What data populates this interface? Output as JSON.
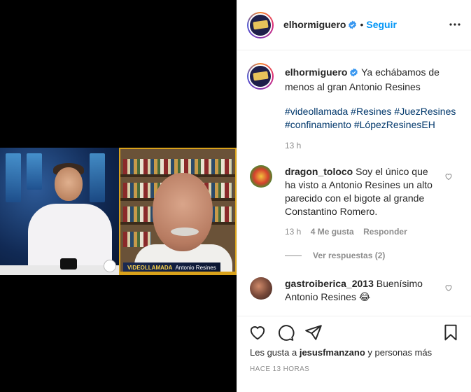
{
  "post": {
    "username": "elhormiguero",
    "follow_label": "Seguir",
    "dot": "•",
    "caption_text": "Ya echábamos de menos al gran Antonio Resines",
    "hashtags": "#videollamada #Resines #JuezResines #confinamiento #LópezResinesEH",
    "caption_time": "13 h",
    "video_overlay": {
      "label": "VIDEOLLAMADA",
      "name": "Antonio Resines"
    }
  },
  "comments": [
    {
      "username": "dragon_toloco",
      "text": "Soy el único que ha visto a Antonio Resines un alto parecido con el bigote al grande Constantino Romero.",
      "time": "13 h",
      "likes": "4 Me gusta",
      "reply_label": "Responder",
      "view_replies": "Ver respuestas (2)"
    },
    {
      "username": "gastroiberica_2013",
      "text": "Buenísimo Antonio Resines 😂"
    }
  ],
  "actions": {
    "likes_prefix": "Les gusta a",
    "liker": "jesusfmanzano",
    "likes_suffix": "y personas más",
    "timestamp": "HACE 13 HORAS"
  },
  "icons": {
    "verified": "verified-badge-icon",
    "more": "more-options-icon",
    "like": "heart-icon",
    "comment": "comment-icon",
    "share": "share-icon",
    "save": "bookmark-icon"
  },
  "colors": {
    "link": "#00376b",
    "follow": "#0095f6",
    "muted": "#8e8e8e",
    "verified": "#3897f0"
  }
}
